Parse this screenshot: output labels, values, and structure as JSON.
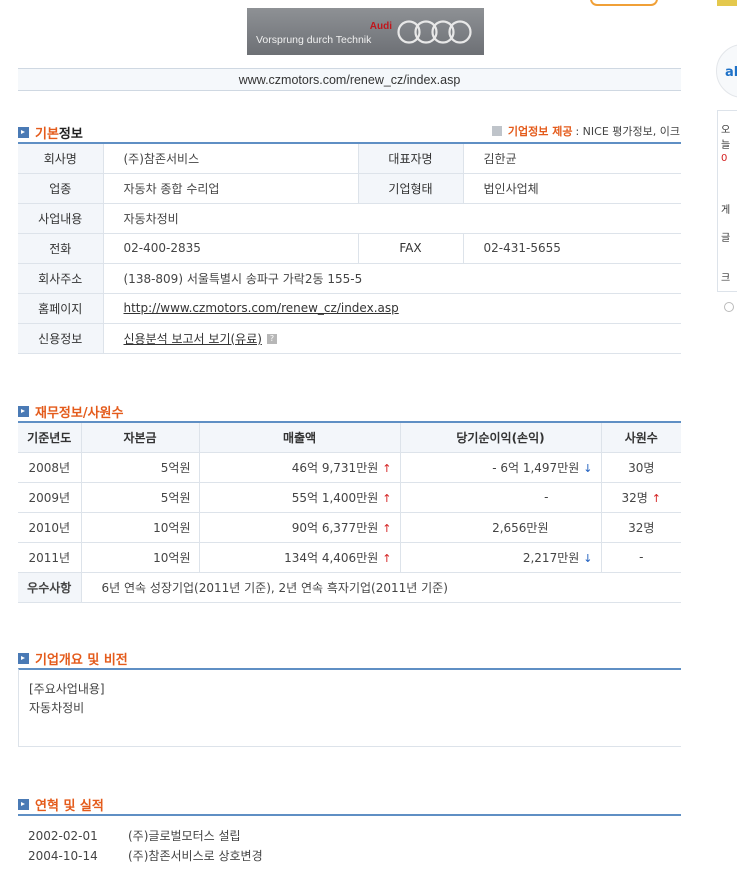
{
  "logo": {
    "brand": "Audi",
    "tagline": "Vorsprung durch Technik"
  },
  "url": "www.czmotors.com/renew_cz/index.asp",
  "basic": {
    "title_hl": "기본",
    "title_rest": "정보",
    "provider_label": "기업정보 제공",
    "provider_value": ": NICE 평가정보, 이크",
    "rows": {
      "company_label": "회사명",
      "company": "(주)참존서비스",
      "ceo_label": "대표자명",
      "ceo": "김한균",
      "industry_label": "업종",
      "industry": "자동차 종합 수리업",
      "type_label": "기업형태",
      "type": "법인사업체",
      "business_label": "사업내용",
      "business": "자동차정비",
      "phone_label": "전화",
      "phone": "02-400-2835",
      "fax_label": "FAX",
      "fax": "02-431-5655",
      "address_label": "회사주소",
      "address": "(138-809) 서울특별시 송파구 가락2동 155-5",
      "homepage_label": "홈페이지",
      "homepage": "http://www.czmotors.com/renew_cz/index.asp",
      "credit_label": "신용정보",
      "credit": "신용분석 보고서 보기(유료)"
    }
  },
  "finance": {
    "title": "재무정보/사원수",
    "headers": [
      "기준년도",
      "자본금",
      "매출액",
      "당기순이익(손익)",
      "사원수"
    ],
    "rows": [
      {
        "year": "2008년",
        "capital": "5억원",
        "sales": "46억 9,731만원",
        "sales_trend": "up",
        "profit": "- 6억 1,497만원",
        "profit_trend": "down",
        "staff": "30명",
        "staff_trend": ""
      },
      {
        "year": "2009년",
        "capital": "5억원",
        "sales": "55억 1,400만원",
        "sales_trend": "up",
        "profit": "-",
        "profit_trend": "",
        "staff": "32명",
        "staff_trend": "up"
      },
      {
        "year": "2010년",
        "capital": "10억원",
        "sales": "90억 6,377만원",
        "sales_trend": "up",
        "profit": "2,656만원",
        "profit_trend": "",
        "staff": "32명",
        "staff_trend": ""
      },
      {
        "year": "2011년",
        "capital": "10억원",
        "sales": "134억 4,406만원",
        "sales_trend": "up",
        "profit": "2,217만원",
        "profit_trend": "down",
        "staff": "-",
        "staff_trend": ""
      }
    ],
    "merit_label": "우수사항",
    "merit": "6년 연속 성장기업(2011년 기준), 2년 연속 흑자기업(2011년 기준)"
  },
  "overview": {
    "title": "기업개요 및 비전",
    "line1": "[주요사업내용]",
    "line2": "자동차정비"
  },
  "history": {
    "title": "연혁 및 실적",
    "items": [
      {
        "date": "2002-02-01",
        "text": "(주)글로벌모터스 설립"
      },
      {
        "date": "2004-10-14",
        "text": "(주)참존서비스로 상호변경"
      }
    ]
  },
  "rail": {
    "ad_text": "al",
    "items": [
      "오늘",
      "0",
      "게",
      "글",
      "크"
    ]
  },
  "colors": {
    "accent": "#e45b1b",
    "header_line": "#5f8fc4",
    "up": "#d42020",
    "down": "#1f5fbf"
  }
}
